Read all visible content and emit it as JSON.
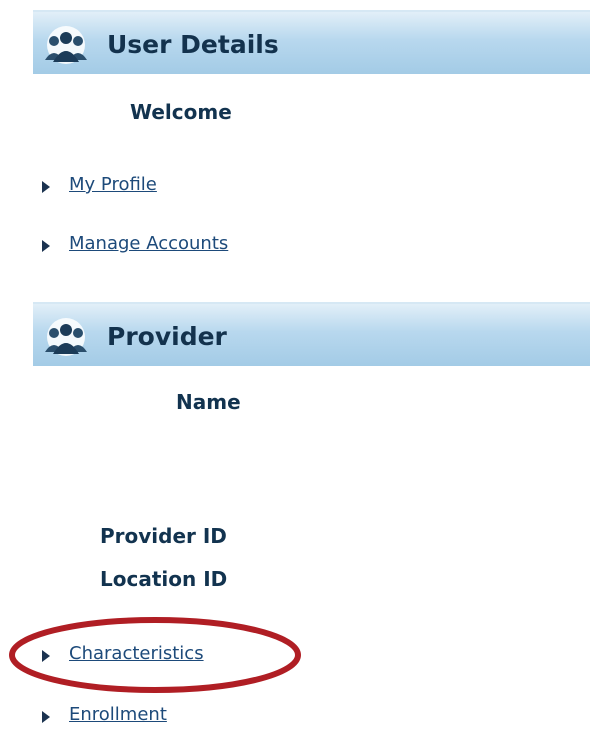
{
  "user_details": {
    "title": "User Details",
    "welcome_label": "Welcome",
    "links": [
      {
        "label": "My Profile"
      },
      {
        "label": "Manage Accounts"
      }
    ]
  },
  "provider": {
    "title": "Provider",
    "name_label": "Name",
    "provider_id_label": "Provider ID",
    "location_id_label": "Location ID",
    "links": [
      {
        "label": "Characteristics"
      },
      {
        "label": "Enrollment"
      }
    ]
  },
  "icons": {
    "header_icon": "users-group-icon",
    "link_bullet": "triangle-right-icon"
  },
  "colors": {
    "header_light": "#e2eff8",
    "header_dark": "#a3cbe6",
    "heading_text": "#13324d",
    "link_text": "#1d4a7a",
    "highlight": "#b01e24"
  }
}
